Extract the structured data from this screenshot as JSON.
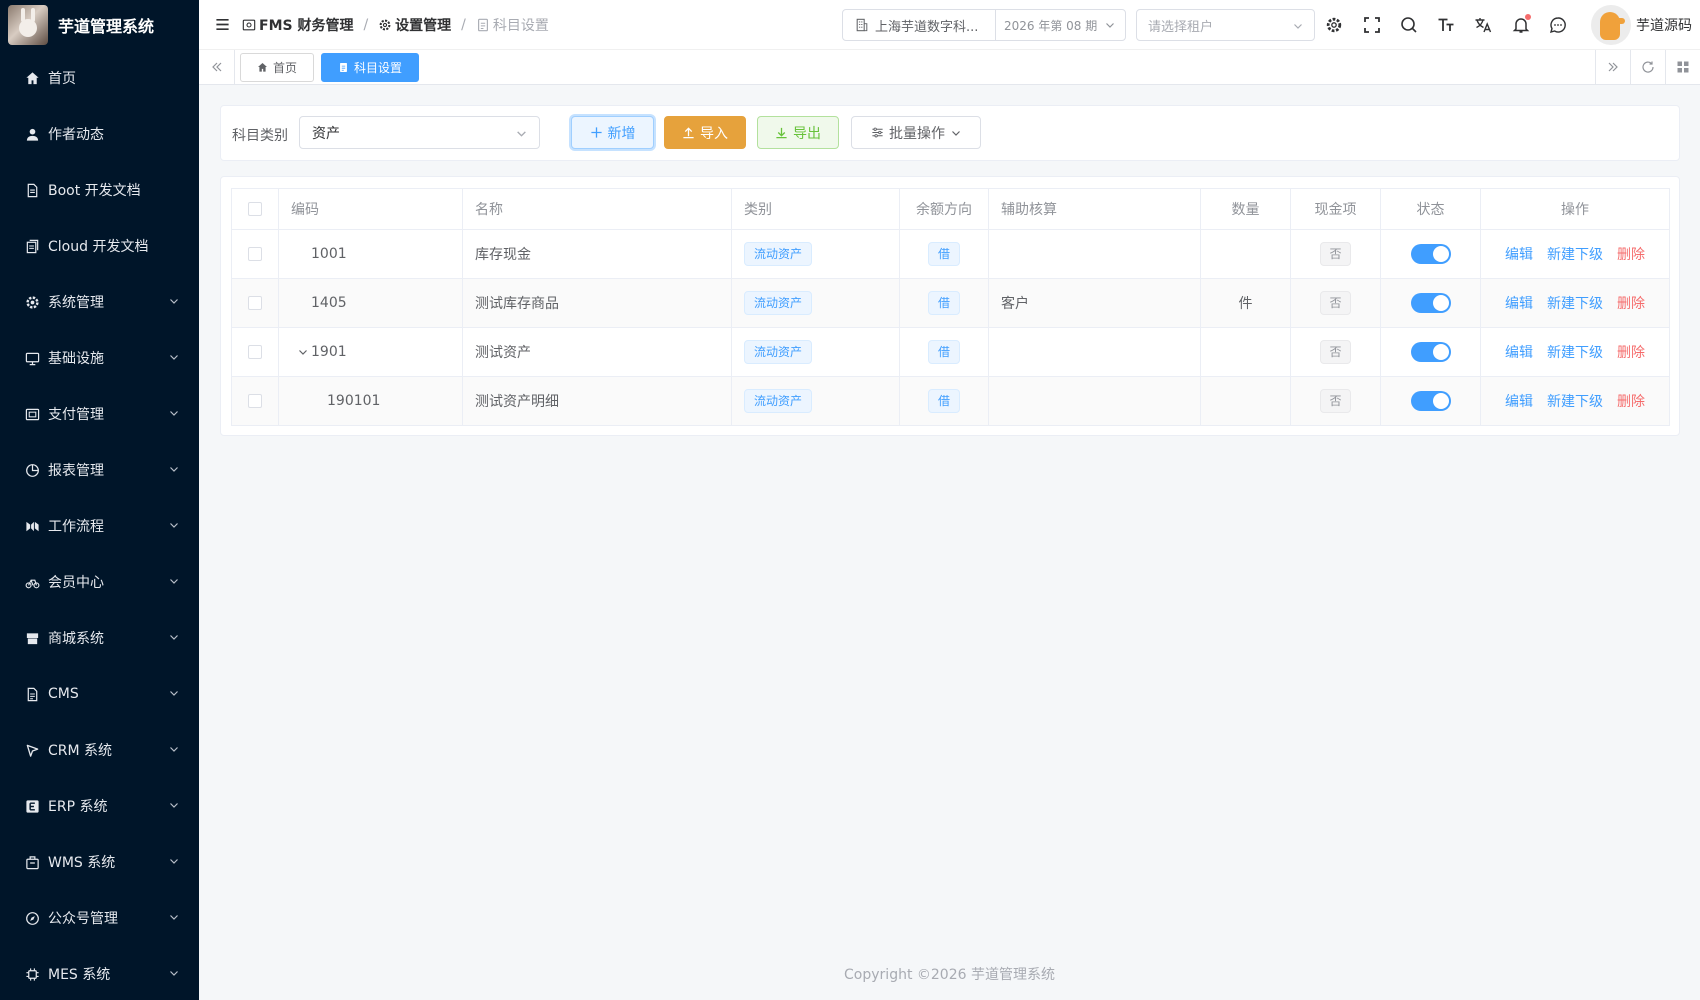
{
  "app": {
    "title": "芋道管理系统",
    "copyright": "Copyright ©2026 芋道管理系统"
  },
  "sidebar": {
    "items": [
      {
        "label": "首页",
        "icon": "home-icon"
      },
      {
        "label": "作者动态",
        "icon": "user-icon"
      },
      {
        "label": "Boot 开发文档",
        "icon": "document-icon"
      },
      {
        "label": "Cloud 开发文档",
        "icon": "documents-icon"
      },
      {
        "label": "系统管理",
        "icon": "gear-icon"
      },
      {
        "label": "基础设施",
        "icon": "monitor-icon"
      },
      {
        "label": "支付管理",
        "icon": "payment-icon"
      },
      {
        "label": "报表管理",
        "icon": "pie-chart-icon"
      },
      {
        "label": "工作流程",
        "icon": "workflow-icon"
      },
      {
        "label": "会员中心",
        "icon": "bicycle-icon"
      },
      {
        "label": "商城系统",
        "icon": "shop-icon"
      },
      {
        "label": "CMS",
        "icon": "cms-icon"
      },
      {
        "label": "CRM 系统",
        "icon": "crm-icon"
      },
      {
        "label": "ERP 系统",
        "icon": "erp-icon"
      },
      {
        "label": "WMS 系统",
        "icon": "wms-icon"
      },
      {
        "label": "公众号管理",
        "icon": "compass-icon"
      },
      {
        "label": "MES 系统",
        "icon": "chip-icon"
      }
    ]
  },
  "header": {
    "breadcrumb": [
      "FMS 财务管理",
      "设置管理",
      "科目设置"
    ],
    "company": "上海芋道数字科...",
    "period": "2026 年第 08 期",
    "tenant_placeholder": "请选择租户",
    "user_name": "芋道源码"
  },
  "tags": {
    "home": "首页",
    "current": "科目设置"
  },
  "search": {
    "label": "科目类别",
    "value": "资产"
  },
  "toolbar": {
    "add": "新增",
    "import": "导入",
    "export": "导出",
    "batch": "批量操作"
  },
  "table": {
    "headers": [
      "编码",
      "名称",
      "类别",
      "余额方向",
      "辅助核算",
      "数量",
      "现金项",
      "状态",
      "操作"
    ],
    "rows": [
      {
        "code": "1001",
        "name": "库存现金",
        "category": "流动资产",
        "direction": "借",
        "aux": "",
        "qty": "",
        "cash": "否"
      },
      {
        "code": "1405",
        "name": "测试库存商品",
        "category": "流动资产",
        "direction": "借",
        "aux": "客户",
        "qty": "件",
        "cash": "否"
      },
      {
        "code": "1901",
        "name": "测试资产",
        "category": "流动资产",
        "direction": "借",
        "aux": "",
        "qty": "",
        "cash": "否"
      },
      {
        "code": "190101",
        "name": "测试资产明细",
        "category": "流动资产",
        "direction": "借",
        "aux": "",
        "qty": "",
        "cash": "否"
      }
    ],
    "actions": {
      "edit": "编辑",
      "add_child": "新建下级",
      "delete": "删除"
    }
  },
  "colors": {
    "sidebar_bg": "#001529",
    "primary": "#409eff",
    "warning": "#e6a23c",
    "success": "#67c23a",
    "danger": "#f56c6c"
  }
}
